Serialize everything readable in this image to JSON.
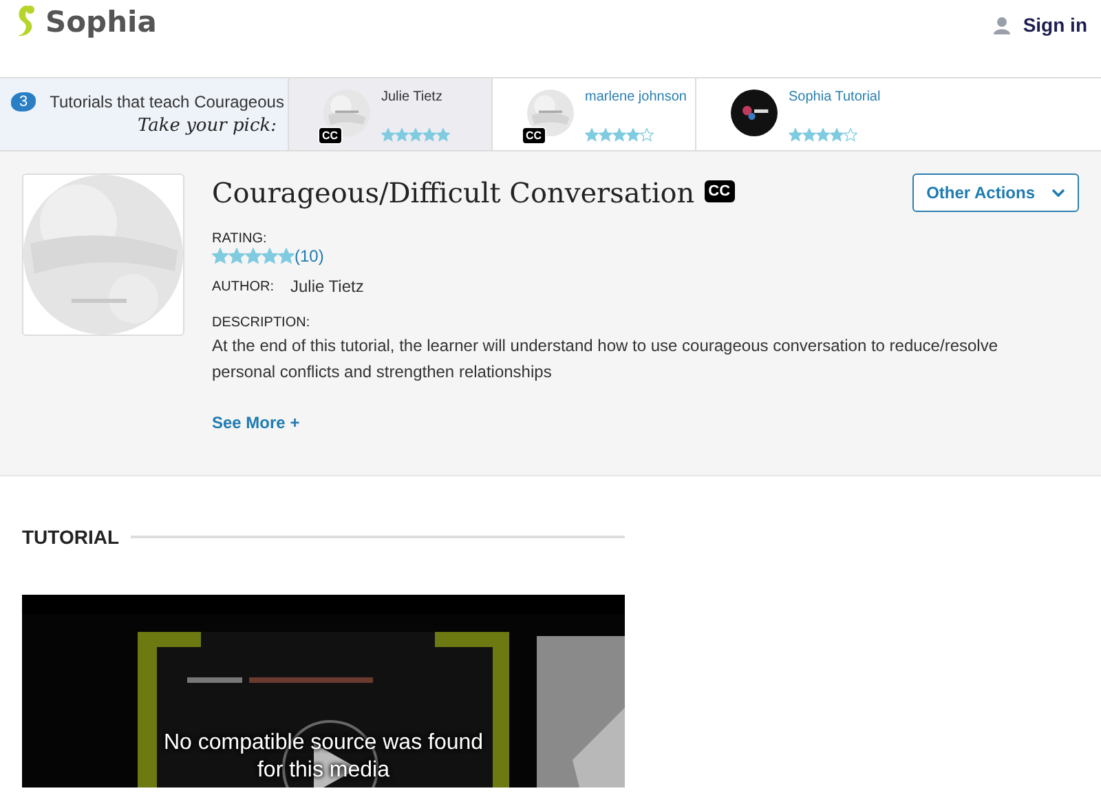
{
  "header": {
    "logo": "Sophia",
    "sign_in": "Sign in"
  },
  "promo": {
    "count": "3",
    "text": "Tutorials that teach Courageous",
    "tagline": "Take your pick:"
  },
  "tutorials": [
    {
      "author": "Julie Tietz",
      "stars": 5,
      "selected": true,
      "cc_label": "CC",
      "kind": "light"
    },
    {
      "author": "marlene johnson",
      "stars": 4,
      "selected": false,
      "cc_label": "CC",
      "kind": "light"
    },
    {
      "author": "Sophia Tutorial",
      "stars": 4,
      "selected": false,
      "kind": "dark"
    }
  ],
  "tutorial_info": {
    "title": "Courageous/Difficult Conversation",
    "cc_label": "CC",
    "actions_button": "Other Actions",
    "rating_label": "RATING:",
    "stars": 5,
    "rating_count": "(10)",
    "author_label": "AUTHOR:",
    "author": "Julie Tietz",
    "description_label": "DESCRIPTION:",
    "description": "At the end of this tutorial, the learner will understand how to use courageous conversation to reduce/resolve personal conflicts and strengthen relationships",
    "see_more": "See More +"
  },
  "section": {
    "heading": "TUTORIAL"
  },
  "video": {
    "kind": "picture",
    "error_message": "No compatible source was found for this media"
  }
}
